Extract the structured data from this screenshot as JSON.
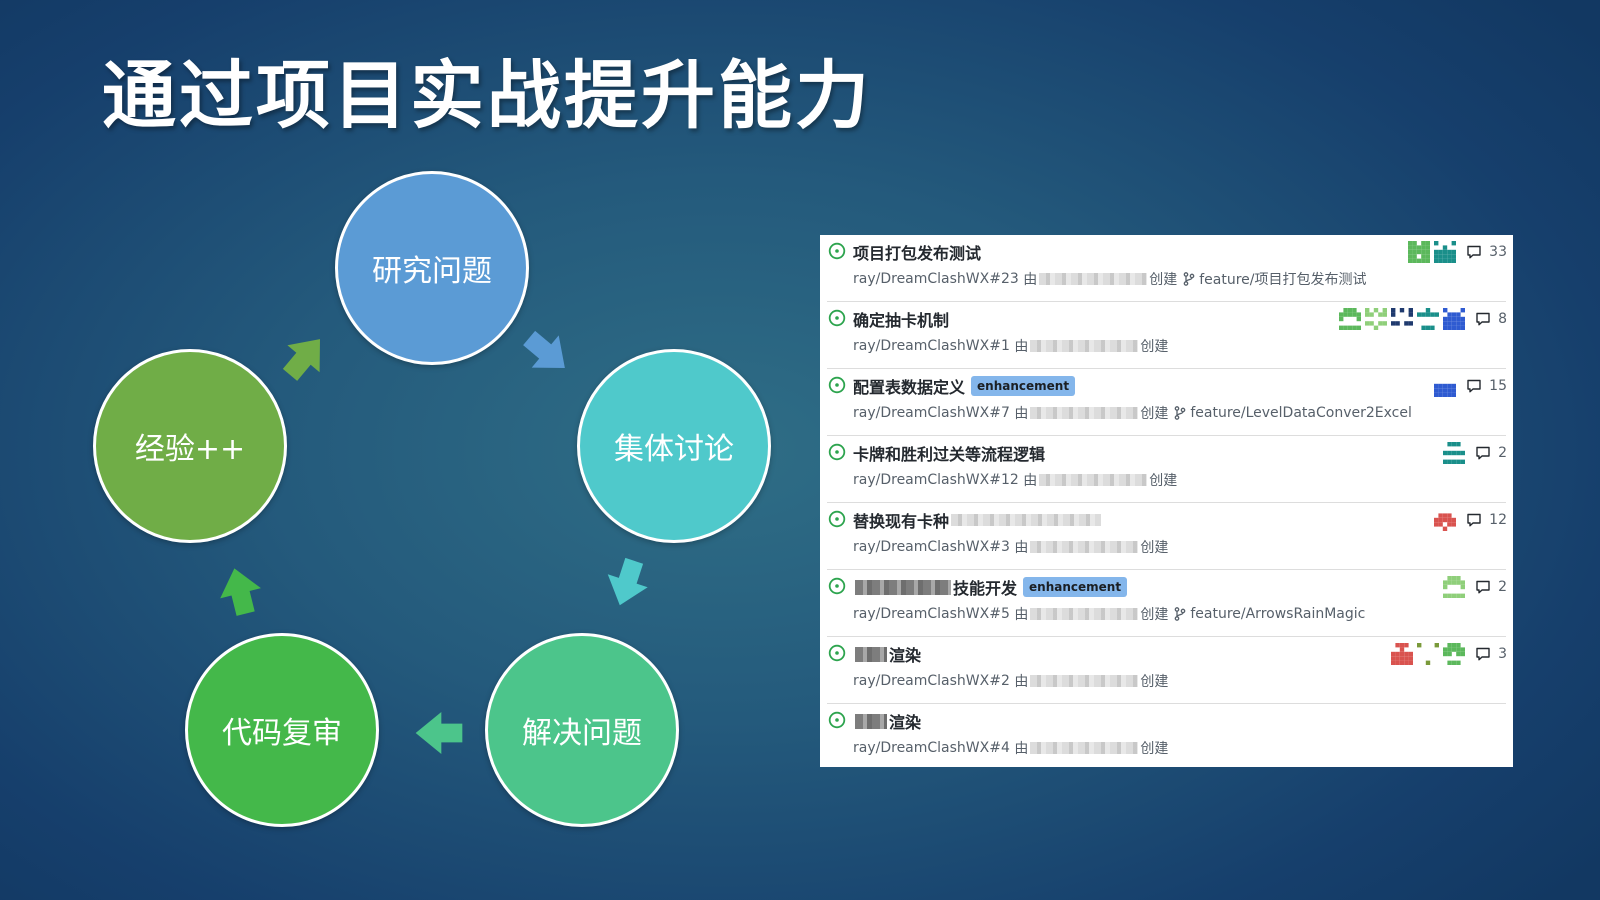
{
  "slide": {
    "title": "通过项目实战提升能力"
  },
  "cycle": {
    "nodes": [
      {
        "label": "研究问题",
        "color": "#5b9bd5"
      },
      {
        "label": "集体讨论",
        "color": "#4fc9cb"
      },
      {
        "label": "解决问题",
        "color": "#4cc58b"
      },
      {
        "label": "代码复审",
        "color": "#44b84a"
      },
      {
        "label": "经验++",
        "color": "#70ad47"
      }
    ]
  },
  "issues": [
    {
      "title": "项目打包发布测试",
      "label": "",
      "repo_ref": "ray/DreamClashWX#23",
      "by": "由",
      "created": "创建",
      "branch": "feature/项目打包发布测试",
      "avatars": [
        "avatar-green",
        "avatar-teal"
      ],
      "comments": "33"
    },
    {
      "title": "确定抽卡机制",
      "label": "",
      "repo_ref": "ray/DreamClashWX#1",
      "by": "由",
      "created": "创建",
      "branch": "",
      "avatars": [
        "avatar-green",
        "avatar-lightgreen",
        "avatar-navy",
        "avatar-teal",
        "avatar-blue"
      ],
      "comments": "8"
    },
    {
      "title": "配置表数据定义",
      "label": "enhancement",
      "repo_ref": "ray/DreamClashWX#7",
      "by": "由",
      "created": "创建",
      "branch": "feature/LevelDataConver2Excel",
      "avatars": [
        "avatar-blue"
      ],
      "comments": "15"
    },
    {
      "title": "卡牌和胜利过关等流程逻辑",
      "label": "",
      "repo_ref": "ray/DreamClashWX#12",
      "by": "由",
      "created": "创建",
      "branch": "",
      "avatars": [
        "avatar-teal"
      ],
      "comments": "2"
    },
    {
      "title": "替换现有卡种",
      "label": "",
      "repo_ref": "ray/DreamClashWX#3",
      "by": "由",
      "created": "创建",
      "branch": "",
      "avatars": [
        "avatar-red"
      ],
      "comments": "12"
    },
    {
      "title": "技能开发",
      "label": "enhancement",
      "repo_ref": "ray/DreamClashWX#5",
      "by": "由",
      "created": "创建",
      "branch": "feature/ArrowsRainMagic",
      "avatars": [
        "avatar-lightgreen"
      ],
      "comments": "2"
    },
    {
      "title": "渲染",
      "label": "",
      "repo_ref": "ray/DreamClashWX#2",
      "by": "由",
      "created": "创建",
      "branch": "",
      "avatars": [
        "avatar-red",
        "avatar-olive",
        "avatar-green"
      ],
      "comments": "3"
    },
    {
      "title": "渲染",
      "label": "",
      "repo_ref": "ray/DreamClashWX#4",
      "by": "由",
      "created": "创建",
      "branch": "",
      "avatars": [],
      "comments": ""
    }
  ],
  "colors": {
    "open_icon": "#2da44e",
    "label_enhancement": "#84b6eb",
    "avatar-green": "#5cb85c",
    "avatar-lightgreen": "#8fcf7a",
    "avatar-teal": "#1a8f8a",
    "avatar-navy": "#1f3a6e",
    "avatar-blue": "#2f5bd1",
    "avatar-red": "#d9534f",
    "avatar-olive": "#7a9a3a"
  }
}
